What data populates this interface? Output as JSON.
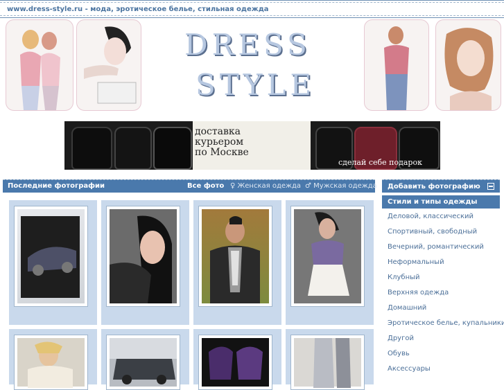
{
  "site_title": "www.dress-style.ru - мода, эротическое белье, стильная одежда",
  "logo": {
    "line1": "DRESS",
    "line2": "STYLE"
  },
  "banner": {
    "text": "доставка\nкурьером\nпо Москве",
    "slogan": "сделай себе подарок"
  },
  "main_bar": {
    "title": "Последние фотографии",
    "all_photos": "Все фото",
    "female": "♀ Женская одежда",
    "male": "♂ Мужская одежда"
  },
  "sidebar": {
    "add_photo": "Добавить фотографию",
    "styles_title": "Стили и типы одежды",
    "items": [
      {
        "label": "Деловой, классический"
      },
      {
        "label": "Спортивный, свободный"
      },
      {
        "label": "Вечерний, романтический"
      },
      {
        "label": "Неформальный"
      },
      {
        "label": "Клубный"
      },
      {
        "label": "Верхняя одежда"
      },
      {
        "label": "Домашний"
      },
      {
        "label": "Эротическое белье, купальники"
      },
      {
        "label": "Другой"
      },
      {
        "label": "Обувь"
      },
      {
        "label": "Аксессуары"
      }
    ]
  },
  "colors": {
    "accent": "#4a79ac",
    "cell_bg": "#c9d9ec",
    "link": "#4b6f98"
  },
  "photos": [
    {
      "name": "photo-car-vintage"
    },
    {
      "name": "photo-woman-portrait"
    },
    {
      "name": "photo-man-scarf"
    },
    {
      "name": "photo-woman-dress"
    },
    {
      "name": "photo-woman-blonde"
    },
    {
      "name": "photo-car-street"
    },
    {
      "name": "photo-purple-items"
    },
    {
      "name": "photo-boots"
    }
  ]
}
